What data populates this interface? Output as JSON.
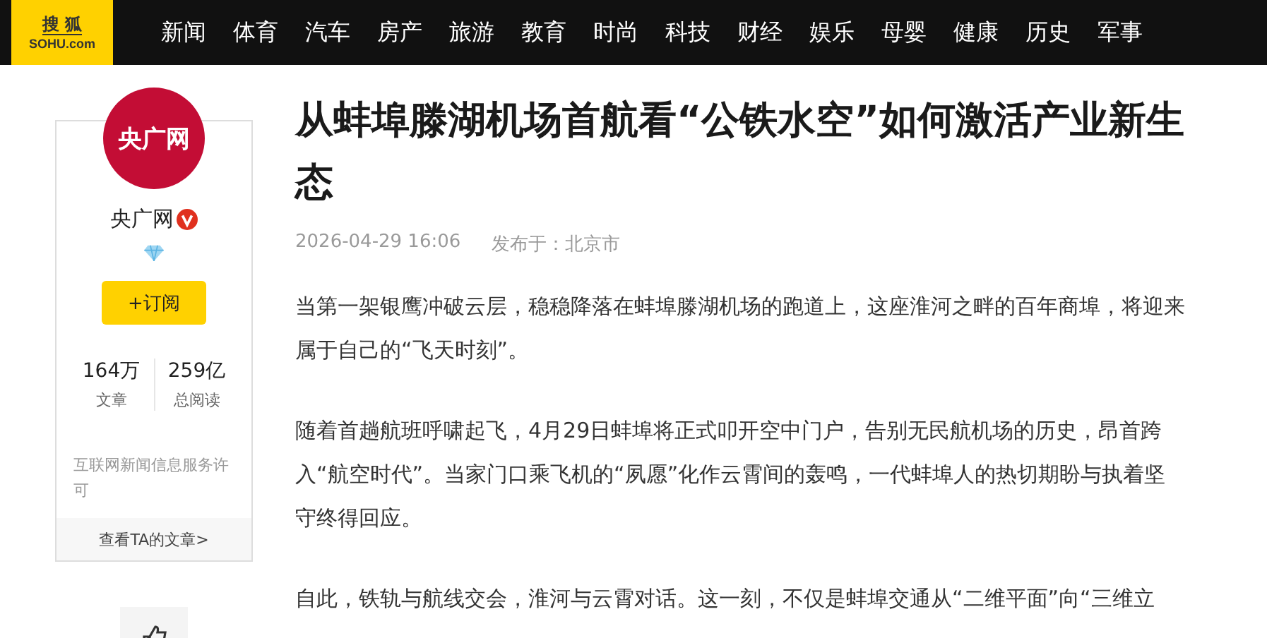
{
  "logo": {
    "name": "搜 狐",
    "domain": "SOHU.com"
  },
  "nav": [
    "新闻",
    "体育",
    "汽车",
    "房产",
    "旅游",
    "教育",
    "时尚",
    "科技",
    "财经",
    "娱乐",
    "母婴",
    "健康",
    "历史",
    "军事"
  ],
  "author": {
    "avatar_text": "央广网",
    "name": "央广网",
    "verified": true,
    "subscribe": "+订阅",
    "stats": [
      {
        "value": "164万",
        "label": "文章"
      },
      {
        "value": "259亿",
        "label": "总阅读"
      }
    ],
    "license": "互联网新闻信息服务许可",
    "more": "查看TA的文章>"
  },
  "article": {
    "title": "从蚌埠滕湖机场首航看“公铁水空”如何激活产业新生态",
    "time": "2026-04-29 16:06",
    "location": "发布于：北京市",
    "paragraphs": [
      "当第一架银鹰冲破云层，稳稳降落在蚌埠滕湖机场的跑道上，这座淮河之畔的百年商埠，将迎来属于自己的“飞天时刻”。",
      "随着首趟航班呼啸起飞，4月29日蚌埠将正式叩开空中门户，告别无民航机场的历史，昂首跨入“航空时代”。当家门口乘飞机的“夙愿”化作云霄间的轰鸣，一代蚌埠人的热切期盼与执着坚守终得回应。",
      "自此，铁轨与航线交会，淮河与云霄对话。这一刻，不仅是蚌埠交通从“二维平面”向“三维立"
    ]
  }
}
